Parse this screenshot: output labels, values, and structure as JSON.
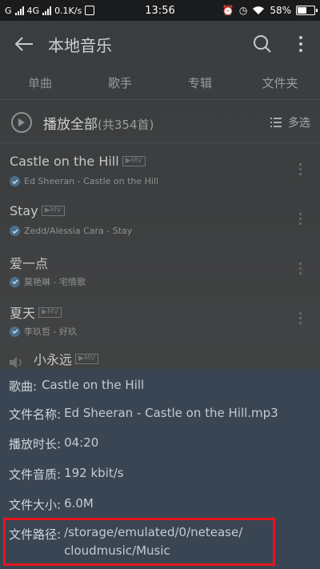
{
  "status_bar": {
    "carrier1": "G",
    "carrier2": "4G",
    "speed": "0.1K/s",
    "time": "13:56",
    "battery": "58%",
    "battery_level": 0.58
  },
  "header": {
    "title": "本地音乐",
    "back_icon": "back-arrow-icon",
    "search_icon": "search-icon",
    "more_icon": "more-vertical-icon"
  },
  "tabs": [
    {
      "label": "单曲",
      "active": true
    },
    {
      "label": "歌手",
      "active": false
    },
    {
      "label": "专辑",
      "active": false
    },
    {
      "label": "文件夹",
      "active": false
    }
  ],
  "play_all": {
    "label": "播放全部",
    "count": "(共354首)",
    "multi_select": "多选"
  },
  "songs": [
    {
      "title": "Castle on the Hill",
      "mv": "MV",
      "subtitle": "Ed Sheeran - Castle on the Hill"
    },
    {
      "title": "Stay",
      "mv": "MV",
      "subtitle": "Zedd/Alessia Cara - Stay"
    },
    {
      "title": "爱一点",
      "mv": "",
      "subtitle": "莫艳琳 - 宅情歌"
    },
    {
      "title": "夏天",
      "mv": "MV",
      "subtitle": "李玖哲 - 好玖"
    },
    {
      "title": "小永远",
      "mv": "MV",
      "subtitle": ""
    }
  ],
  "info": {
    "song_key": "歌曲:",
    "song_val": "Castle on the Hill",
    "filename_key": "文件名称:",
    "filename_val": "Ed Sheeran - Castle on the Hill.mp3",
    "duration_key": "播放时长:",
    "duration_val": "04:20",
    "quality_key": "文件音质:",
    "quality_val": "192 kbit/s",
    "size_key": "文件大小:",
    "size_val": "6.0M",
    "path_key": "文件路径:",
    "path_val_line1": "/storage/emulated/0/netease/",
    "path_val_line2": "cloudmusic/Music"
  },
  "colors": {
    "highlight_border": "#e5161e",
    "sheet_bg": "#3a4553"
  }
}
